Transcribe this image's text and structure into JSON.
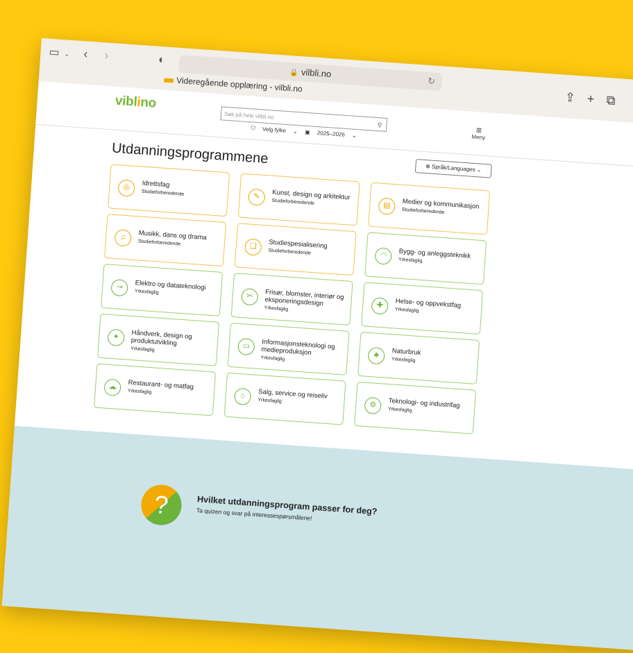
{
  "browser": {
    "url": "vilbli.no",
    "tab_title": "Videregående opplæring - vilbli.no"
  },
  "site": {
    "logo": {
      "text_start": "vibl",
      "text_dot": "i",
      "text_end": "no"
    },
    "search_placeholder": "Søk på hele vilbli.no",
    "county_select": "Velg fylke",
    "year_select": "2025–2026",
    "menu_label": "Meny"
  },
  "main": {
    "title": "Utdanningsprogrammene",
    "language_button": "Språk/Languages",
    "programs": [
      {
        "name": "Idrettsfag",
        "type": "Studieforberedende",
        "kind": "studie",
        "icon": "sport-icon"
      },
      {
        "name": "Kunst, design og arkitektur",
        "type": "Studieforberedende",
        "kind": "studie",
        "icon": "pencil-icon"
      },
      {
        "name": "Medier og kommunikasjon",
        "type": "Studieforberedende",
        "kind": "studie",
        "icon": "media-icon"
      },
      {
        "name": "Musikk, dans og drama",
        "type": "Studieforberedende",
        "kind": "studie",
        "icon": "music-icon"
      },
      {
        "name": "Studiespesialisering",
        "type": "Studieforberedende",
        "kind": "studie",
        "icon": "book-icon"
      },
      {
        "name": "Bygg- og anleggsteknikk",
        "type": "Yrkesfaglig",
        "kind": "yrke",
        "icon": "helmet-icon"
      },
      {
        "name": "Elektro og datateknologi",
        "type": "Yrkesfaglig",
        "kind": "yrke",
        "icon": "plug-icon"
      },
      {
        "name": "Frisør, blomster, interiør og eksponeringsdesign",
        "type": "Yrkesfaglig",
        "kind": "yrke",
        "icon": "scissors-icon"
      },
      {
        "name": "Helse- og oppvekstfag",
        "type": "Yrkesfaglig",
        "kind": "yrke",
        "icon": "health-icon"
      },
      {
        "name": "Håndverk, design og produktutvikling",
        "type": "Yrkesfaglig",
        "kind": "yrke",
        "icon": "craft-icon"
      },
      {
        "name": "Informasjonsteknologi og medieproduksjon",
        "type": "Yrkesfaglig",
        "kind": "yrke",
        "icon": "monitor-icon"
      },
      {
        "name": "Naturbruk",
        "type": "Yrkesfaglig",
        "kind": "yrke",
        "icon": "tree-icon"
      },
      {
        "name": "Restaurant- og matfag",
        "type": "Yrkesfaglig",
        "kind": "yrke",
        "icon": "chef-hat-icon"
      },
      {
        "name": "Salg, service og reiseliv",
        "type": "Yrkesfaglig",
        "kind": "yrke",
        "icon": "shop-icon"
      },
      {
        "name": "Teknologi- og industrifag",
        "type": "Yrkesfaglig",
        "kind": "yrke",
        "icon": "gear-icon"
      }
    ]
  },
  "quiz": {
    "icon_symbol": "?",
    "title": "Hvilket utdanningsprogram passer for deg?",
    "subtitle": "Ta quizen og svar på interessespørsmålene!"
  },
  "colors": {
    "background": "#FFC90F",
    "studie_border": "#F2C14E",
    "yrke_border": "#9AD06E",
    "banner": "#CCE3E7"
  }
}
